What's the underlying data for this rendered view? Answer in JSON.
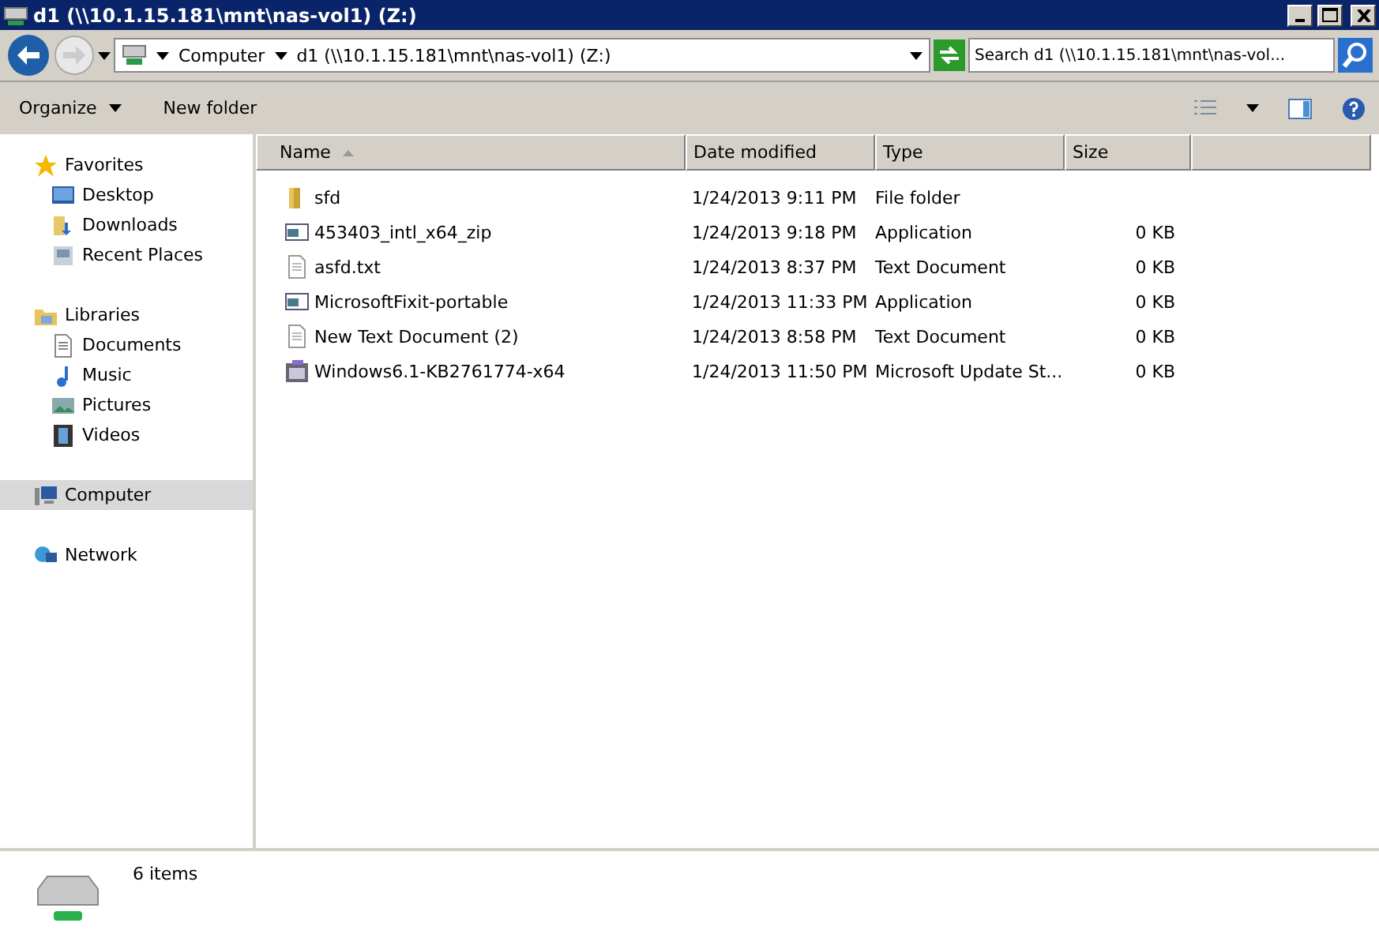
{
  "window": {
    "title": "d1 (\\\\10.1.15.181\\mnt\\nas-vol1) (Z:)"
  },
  "address": {
    "crumbs": [
      "Computer",
      "d1 (\\\\10.1.15.181\\mnt\\nas-vol1) (Z:)"
    ]
  },
  "search": {
    "placeholder": "Search d1 (\\\\10.1.15.181\\mnt\\nas-vol..."
  },
  "toolbar": {
    "buttons": [
      "Organize",
      "New folder"
    ]
  },
  "sidebar": {
    "items": [
      {
        "label": "Favorites",
        "selected": false,
        "children": [
          {
            "label": "Desktop",
            "selected": false
          },
          {
            "label": "Downloads",
            "selected": false
          },
          {
            "label": "Recent Places",
            "selected": false
          }
        ]
      },
      {
        "label": "Libraries",
        "selected": false,
        "children": [
          {
            "label": "Documents",
            "selected": false
          },
          {
            "label": "Music",
            "selected": false
          },
          {
            "label": "Pictures",
            "selected": false
          },
          {
            "label": "Videos",
            "selected": false
          }
        ]
      },
      {
        "label": "Computer",
        "selected": true
      },
      {
        "label": "Network",
        "selected": false
      }
    ]
  },
  "table": {
    "columns": [
      {
        "label": "Name",
        "sorted": true
      },
      {
        "label": "Date modified",
        "sorted": false
      },
      {
        "label": "Type",
        "sorted": false
      },
      {
        "label": "Size",
        "sorted": false
      }
    ],
    "rows": [
      {
        "kind": "folder",
        "name": "sfd",
        "date": "1/24/2013 9:11 PM",
        "type": "File folder"
      },
      {
        "kind": "application",
        "name": "453403_intl_x64_zip",
        "date": "1/24/2013 9:18 PM",
        "type": "Application",
        "size": "0 KB"
      },
      {
        "kind": "text",
        "name": "asfd.txt",
        "date": "1/24/2013 8:37 PM",
        "type": "Text Document",
        "size": "0 KB"
      },
      {
        "kind": "application",
        "name": "MicrosoftFixit-portable",
        "date": "1/24/2013 11:33 PM",
        "type": "Application",
        "size": "0 KB"
      },
      {
        "kind": "text",
        "name": "New Text Document (2)",
        "date": "1/24/2013 8:58 PM",
        "type": "Text Document",
        "size": "0 KB"
      },
      {
        "kind": "update",
        "name": "Windows6.1-KB2761774-x64",
        "date": "1/24/2013 11:50 PM",
        "type": "Microsoft Update St...",
        "size": "0 KB"
      }
    ]
  },
  "details": {
    "count": "6 items"
  }
}
